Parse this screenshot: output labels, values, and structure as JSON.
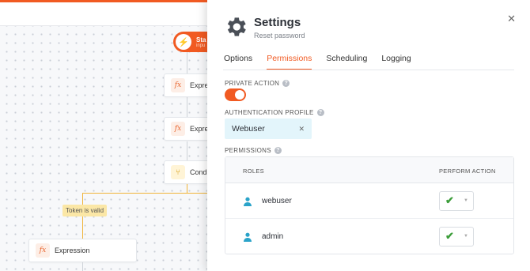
{
  "canvas": {
    "start_node": {
      "label": "Sta",
      "sub": "inpu"
    },
    "nodes": [
      {
        "label": "Express"
      },
      {
        "label": "Express"
      },
      {
        "label": "Conditi"
      }
    ],
    "token_label": "Token is valid",
    "bottom_node": {
      "label": "Expression"
    }
  },
  "panel": {
    "title": "Settings",
    "subtitle": "Reset password",
    "tabs": [
      "Options",
      "Permissions",
      "Scheduling",
      "Logging"
    ],
    "active_tab": "Permissions",
    "private_action": {
      "label": "PRIVATE ACTION",
      "enabled": true
    },
    "auth_profile": {
      "label": "AUTHENTICATION PROFILE",
      "value": "Webuser"
    },
    "permissions": {
      "label": "PERMISSIONS",
      "columns": [
        "ROLES",
        "PERFORM ACTION"
      ],
      "rows": [
        {
          "role": "webuser",
          "perform": true
        },
        {
          "role": "admin",
          "perform": true
        }
      ]
    }
  },
  "colors": {
    "accent": "#f15a22",
    "chip_bg": "#e3f5fb",
    "check": "#3c9d3a",
    "user_icon": "#2aa3c9"
  }
}
